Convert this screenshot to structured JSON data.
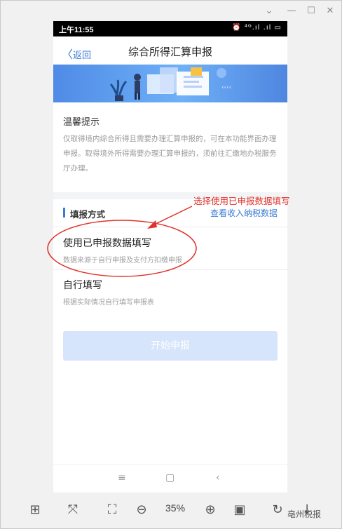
{
  "status": {
    "time": "上午11:55",
    "icons": "⏰ ⁴ᴳ.ıl .ıl ▭"
  },
  "nav": {
    "back": "返回",
    "title": "综合所得汇算申报"
  },
  "tips": {
    "heading": "温馨提示",
    "body": "仅取得境内综合所得且需要办理汇算申报的，可在本功能界面办理申报。取得境外所得需要办理汇算申报的，须前往汇缴地办税服务厅办理。"
  },
  "method": {
    "title": "填报方式",
    "link": "查看收入纳税数据",
    "options": [
      {
        "title": "使用已申报数据填写",
        "desc": "数据来源于自行申报及支付方扣缴申报"
      },
      {
        "title": "自行填写",
        "desc": "根据实际情况自行填写申报表"
      }
    ]
  },
  "start_button": "开始申报",
  "annotation": "选择使用已申报数据填写",
  "viewer": {
    "zoom": "35%",
    "watermark": "亳州税报"
  }
}
